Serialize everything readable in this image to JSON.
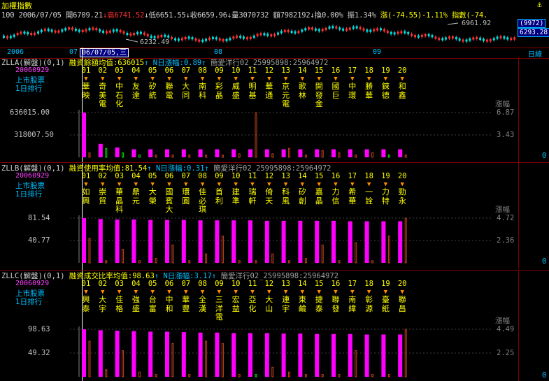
{
  "header": {
    "title": "加權指數",
    "quote": {
      "code": "100",
      "date": "2006/07/05",
      "open_label": "開",
      "open": "6709.21",
      "high_label": "高",
      "high": "6741.52",
      "low_label": "低",
      "low": "6651.55",
      "close_label": "收",
      "close": "6659.96",
      "volume_label": "量",
      "volume": "3070732",
      "amount_label": "額",
      "amount": "7982192",
      "turnover_label": "換",
      "turnover": "0.00%",
      "amplitude_label": "振",
      "amplitude": "1.34%",
      "change_label": "漲",
      "change": "(-74.55)-1.11%",
      "index_label": "指數(-74."
    }
  },
  "index_chart": {
    "max_label": "6961.92",
    "min_label": "6232.49",
    "right_high": "(9972)",
    "right_low": "6293.28"
  },
  "time_axis": {
    "ticks": [
      "2006",
      "07",
      "08",
      "09"
    ],
    "cursor_date": "06/07/05,三",
    "period": "日線"
  },
  "panels": [
    {
      "id": "ZLLA(解盤)(0,1)",
      "avg_text": "融資餘額均值:636015",
      "n_text": "N日漲幅:0.89",
      "source": "簡愛洋行02_25995898:25964972",
      "date": "20060929",
      "cat1": "上市股票",
      "cat2": "1日排行",
      "ranks": [
        "01",
        "02",
        "03",
        "04",
        "05",
        "06",
        "07",
        "08",
        "09",
        "10",
        "11",
        "12",
        "13",
        "14",
        "15",
        "16",
        "17",
        "18",
        "19",
        "20"
      ],
      "stocks": [
        "華映",
        "奇美電",
        "中石化",
        "友達",
        "矽統",
        "聯電",
        "大同",
        "南科",
        "彩晶",
        "威盛",
        "明基",
        "華通",
        "京元電",
        "歌林",
        "開發金",
        "國巨",
        "中環",
        "勝華",
        "錸德",
        "和鑫"
      ],
      "y_top": "636015.00",
      "y_mid": "318007.50",
      "right_label": "漲幅",
      "r_top": "6.87",
      "r_mid": "3.43",
      "zero": "0",
      "mag": [
        1.0,
        0.3,
        0.22,
        0.18,
        0.18,
        0.18,
        0.18,
        0.18,
        0.18,
        0.18,
        0.18,
        0.18,
        0.18,
        0.18,
        0.18,
        0.18,
        0.18,
        0.18,
        0.18,
        0.18
      ],
      "pct": [
        0.1,
        0.2,
        0.1,
        0.05,
        0.05,
        0.05,
        0.05,
        0.05,
        0.05,
        0.08,
        1.0,
        0.08,
        0.2,
        0.05,
        0.15,
        0.1,
        0.05,
        0.1,
        0.05,
        0.05
      ],
      "pct_color": [
        "r",
        "g",
        "g",
        "g",
        "r",
        "r",
        "r",
        "r",
        "r",
        "r",
        "r",
        "r",
        "r",
        "r",
        "r",
        "r",
        "r",
        "r",
        "g",
        "r"
      ]
    },
    {
      "id": "ZLLB(解盤)(0,1)",
      "avg_text": "融資使用率均值:81.54",
      "n_text": "N日漲幅:0.31",
      "source": "簡愛洋行02_25995898:25964972",
      "date": "20060929",
      "cat1": "上市股票",
      "cat2": "1日排行",
      "ranks": [
        "01",
        "02",
        "03",
        "04",
        "05",
        "06",
        "07",
        "08",
        "09",
        "10",
        "11",
        "12",
        "13",
        "14",
        "15",
        "16",
        "17",
        "18",
        "19",
        "20"
      ],
      "stocks": [
        "如興",
        "崇貿",
        "華晶科",
        "鼎元",
        "大榮",
        "國賓大",
        "環圓",
        "佳必琪",
        "首利",
        "建準",
        "瑞軒",
        "倚天",
        "科風",
        "矽創",
        "嘉晶",
        "力信",
        "希華",
        "一詮",
        "力特",
        "勁永"
      ],
      "y_top": "81.54",
      "y_mid": "40.77",
      "right_label": "漲幅",
      "r_top": "4.72",
      "r_mid": "2.36",
      "zero": "0",
      "mag": [
        1.0,
        0.98,
        0.97,
        0.97,
        0.96,
        0.96,
        0.96,
        0.95,
        0.95,
        0.95,
        0.95,
        0.94,
        0.94,
        0.94,
        0.94,
        0.94,
        0.93,
        0.93,
        0.93,
        0.93
      ],
      "pct": [
        0.55,
        0.05,
        0.3,
        0.05,
        0.1,
        0.4,
        0.05,
        0.2,
        0.6,
        0.05,
        0.05,
        0.2,
        0.05,
        0.1,
        0.4,
        0.05,
        0.45,
        0.05,
        0.6,
        1.0
      ],
      "pct_color": [
        "r",
        "r",
        "r",
        "r",
        "r",
        "r",
        "r",
        "r",
        "r",
        "r",
        "r",
        "r",
        "r",
        "r",
        "r",
        "r",
        "r",
        "r",
        "r",
        "r"
      ]
    },
    {
      "id": "ZLLC(解盤)(0,1)",
      "avg_text": "融資成交比率均值:98.63",
      "n_text": "N日漲幅:3.17",
      "source": "簡愛洋行02_25995898:25964972",
      "date": "20060929",
      "cat1": "上市股票",
      "cat2": "1日排行",
      "ranks": [
        "01",
        "02",
        "03",
        "04",
        "05",
        "06",
        "07",
        "08",
        "09",
        "10",
        "11",
        "12",
        "13",
        "14",
        "15",
        "16",
        "17",
        "18",
        "19",
        "20"
      ],
      "stocks": [
        "興泰",
        "大宇",
        "佳格",
        "強盛",
        "台富",
        "中和",
        "華豐",
        "全漢",
        "三洋電",
        "宏益",
        "亞化",
        "大山",
        "連宇",
        "東鹼",
        "捷泰",
        "聯發",
        "南緯",
        "彰源",
        "臺紙",
        "聯昌"
      ],
      "y_top": "98.63",
      "y_mid": "49.32",
      "right_label": "漲幅",
      "r_top": "4.49",
      "r_mid": "2.25",
      "zero": "0",
      "mag": [
        1.0,
        0.98,
        0.97,
        0.96,
        0.95,
        0.95,
        0.94,
        0.93,
        0.93,
        0.92,
        0.92,
        0.92,
        0.91,
        0.91,
        0.9,
        0.9,
        0.9,
        0.89,
        0.89,
        0.89
      ],
      "pct": [
        0.75,
        0.15,
        0.55,
        0.1,
        0.05,
        0.7,
        0.05,
        0.75,
        0.7,
        0.05,
        0.05,
        0.2,
        0.1,
        0.05,
        0.05,
        0.05,
        0.55,
        0.05,
        0.05,
        1.0
      ],
      "pct_color": [
        "r",
        "r",
        "r",
        "r",
        "r",
        "r",
        "r",
        "r",
        "r",
        "r",
        "g",
        "r",
        "r",
        "r",
        "r",
        "r",
        "r",
        "r",
        "r",
        "r"
      ]
    }
  ]
}
